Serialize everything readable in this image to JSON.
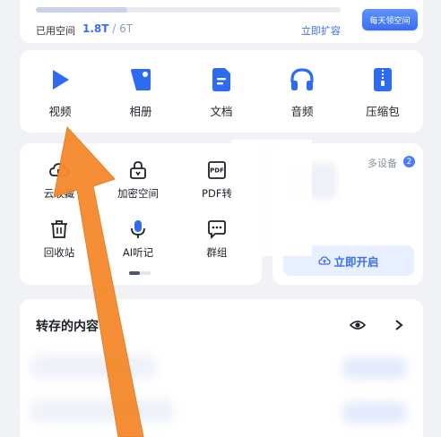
{
  "storage": {
    "used_label": "已用空间",
    "used": "1.8T",
    "separator": " / ",
    "total": "6T",
    "used_fraction": 0.3,
    "expand_label": "立即扩容",
    "daily_label": "每天领空间"
  },
  "categories": [
    {
      "label": "视频",
      "icon": "play-icon"
    },
    {
      "label": "相册",
      "icon": "album-icon"
    },
    {
      "label": "文档",
      "icon": "document-icon"
    },
    {
      "label": "音频",
      "icon": "headphones-icon"
    },
    {
      "label": "压缩包",
      "icon": "zip-icon"
    }
  ],
  "tools": [
    {
      "label": "云收藏",
      "icon": "cloud-bookmark-icon"
    },
    {
      "label": "加密空间",
      "icon": "lock-icon"
    },
    {
      "label": "PDF转",
      "icon": "pdf-icon"
    },
    {
      "label": "回收站",
      "icon": "trash-icon"
    },
    {
      "label": "AI听记",
      "icon": "microphone-icon"
    },
    {
      "label": "群组",
      "icon": "chat-group-icon"
    }
  ],
  "devices": {
    "label": "多设备",
    "count": "2",
    "open_label": "立即开启"
  },
  "saved": {
    "title": "转存的内容"
  },
  "colors": {
    "accent": "#3a6ef2",
    "arrow": "#f58a2e",
    "background": "#f1f2f6"
  }
}
